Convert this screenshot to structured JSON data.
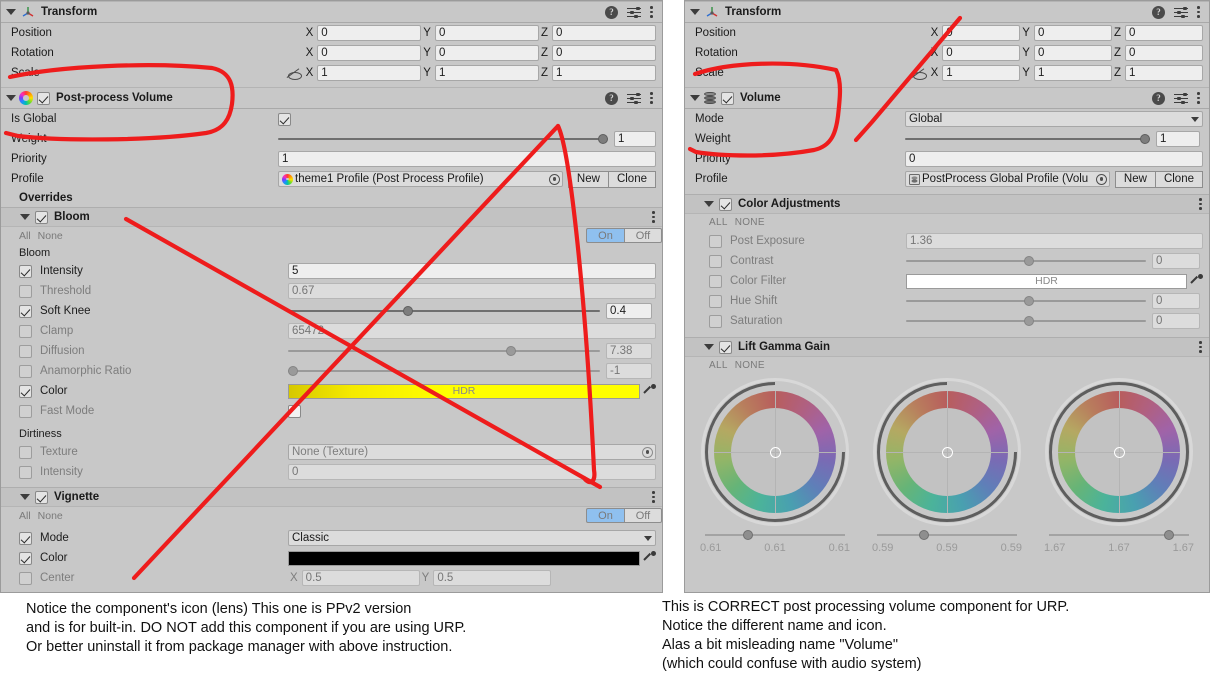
{
  "colors": {
    "red_annotation": "#ee1c1c",
    "toggle_on": "#8fc0ef",
    "bloom_color": "#ffe900",
    "vignette_color": "#000000"
  },
  "left_panel": {
    "transform": {
      "title": "Transform",
      "rows": [
        {
          "label": "Position",
          "x": "0",
          "y": "0",
          "z": "0"
        },
        {
          "label": "Rotation",
          "x": "0",
          "y": "0",
          "z": "0"
        },
        {
          "label": "Scale",
          "x": "1",
          "y": "1",
          "z": "1"
        }
      ],
      "axis_x": "X",
      "axis_y": "Y",
      "axis_z": "Z"
    },
    "component": {
      "title": "Post-process Volume",
      "is_global_label": "Is Global",
      "is_global_checked": true,
      "weight_label": "Weight",
      "weight_value": "1",
      "weight_fill": 100,
      "priority_label": "Priority",
      "priority_value": "1",
      "profile_label": "Profile",
      "profile_value": "theme1 Profile (Post Process Profile)",
      "new_label": "New",
      "clone_label": "Clone",
      "overrides_label": "Overrides"
    },
    "bloom": {
      "title": "Bloom",
      "all_label": "All",
      "none_label": "None",
      "on_label": "On",
      "off_label": "Off",
      "section_label": "Bloom",
      "rows": [
        {
          "label": "Intensity",
          "checked": true,
          "kind": "text",
          "value": "5"
        },
        {
          "label": "Threshold",
          "checked": false,
          "kind": "text",
          "value": "0.67"
        },
        {
          "label": "Soft Knee",
          "checked": true,
          "kind": "slider",
          "value": "0.4",
          "fill": 37
        },
        {
          "label": "Clamp",
          "checked": false,
          "kind": "text",
          "value": "65472"
        },
        {
          "label": "Diffusion",
          "checked": false,
          "kind": "slider",
          "value": "7.38",
          "fill": 70
        },
        {
          "label": "Anamorphic Ratio",
          "checked": false,
          "kind": "slider",
          "value": "-1",
          "fill": 0
        },
        {
          "label": "Color",
          "checked": true,
          "kind": "color",
          "value": "HDR"
        },
        {
          "label": "Fast Mode",
          "checked": false,
          "kind": "check",
          "value": ""
        }
      ],
      "dirtiness_label": "Dirtiness",
      "dirtiness_rows": [
        {
          "label": "Texture",
          "checked": false,
          "kind": "object",
          "value": "None (Texture)"
        },
        {
          "label": "Intensity",
          "checked": false,
          "kind": "text",
          "value": "0"
        }
      ]
    },
    "vignette": {
      "title": "Vignette",
      "all_label": "All",
      "none_label": "None",
      "on_label": "On",
      "off_label": "Off",
      "rows": [
        {
          "label": "Mode",
          "checked": true,
          "kind": "dropdown",
          "value": "Classic"
        },
        {
          "label": "Color",
          "checked": true,
          "kind": "swatch",
          "value": ""
        },
        {
          "label": "Center",
          "checked": false,
          "kind": "vector2",
          "x": "0.5",
          "y": "0.5"
        }
      ],
      "axis_x": "X",
      "axis_y": "Y"
    }
  },
  "right_panel": {
    "transform": {
      "title": "Transform",
      "rows": [
        {
          "label": "Position",
          "x": "0",
          "y": "0",
          "z": "0"
        },
        {
          "label": "Rotation",
          "x": "0",
          "y": "0",
          "z": "0"
        },
        {
          "label": "Scale",
          "x": "1",
          "y": "1",
          "z": "1"
        }
      ],
      "axis_x": "X",
      "axis_y": "Y",
      "axis_z": "Z"
    },
    "component": {
      "title": "Volume",
      "mode_label": "Mode",
      "mode_value": "Global",
      "weight_label": "Weight",
      "weight_value": "1",
      "weight_fill": 100,
      "priority_label": "Priority",
      "priority_value": "0",
      "profile_label": "Profile",
      "profile_value": "PostProcess Global Profile (Volu",
      "new_label": "New",
      "clone_label": "Clone"
    },
    "color_adjustments": {
      "title": "Color Adjustments",
      "all_label": "ALL",
      "none_label": "NONE",
      "rows": [
        {
          "label": "Post Exposure",
          "checked": false,
          "kind": "text",
          "value": "1.36"
        },
        {
          "label": "Contrast",
          "checked": false,
          "kind": "slider",
          "value": "0",
          "fill": 49
        },
        {
          "label": "Color Filter",
          "checked": false,
          "kind": "color",
          "value": "HDR"
        },
        {
          "label": "Hue Shift",
          "checked": false,
          "kind": "slider",
          "value": "0",
          "fill": 49
        },
        {
          "label": "Saturation",
          "checked": false,
          "kind": "slider",
          "value": "0",
          "fill": 49
        }
      ]
    },
    "lift_gamma_gain": {
      "title": "Lift Gamma Gain",
      "all_label": "ALL",
      "none_label": "NONE",
      "wheels": [
        {
          "values": [
            "0.61",
            "0.61",
            "0.61"
          ],
          "slider_fill": 27
        },
        {
          "values": [
            "0.59",
            "0.59",
            "0.59"
          ],
          "slider_fill": 30
        },
        {
          "values": [
            "1.67",
            "1.67",
            "1.67"
          ],
          "slider_fill": 82
        }
      ]
    }
  },
  "captions": {
    "left": "Notice the component's icon (lens) This one is PPv2 version\nand is for built-in. DO NOT add this component if you are using URP.\nOr better uninstall it from package manager with above instruction.",
    "right": "This is CORRECT post processing volume component for URP.\nNotice the different name and icon.\nAlas a bit misleading name \"Volume\"\n(which could confuse with audio system)"
  }
}
